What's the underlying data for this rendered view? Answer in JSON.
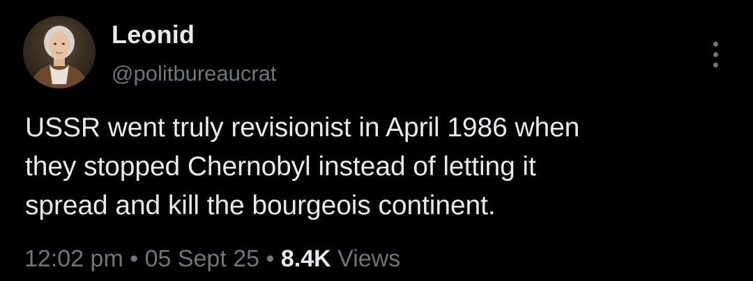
{
  "author": {
    "display_name": "Leonid",
    "handle": "@politbureaucrat",
    "avatar_icon": "portrait-avatar"
  },
  "tweet": {
    "text": "USSR went truly revisionist in April 1986 when\nthey stopped Chernobyl instead of letting it\nspread and kill the bourgeois continent."
  },
  "meta": {
    "time": "12:02 pm",
    "separator": "•",
    "date": "05 Sept 25",
    "views_count": "8.4K",
    "views_label": "Views"
  },
  "more_icon": "more-vertical-icon",
  "colors": {
    "background": "#000000",
    "primary_text": "#e7e9ea",
    "secondary_text": "#71767b"
  }
}
